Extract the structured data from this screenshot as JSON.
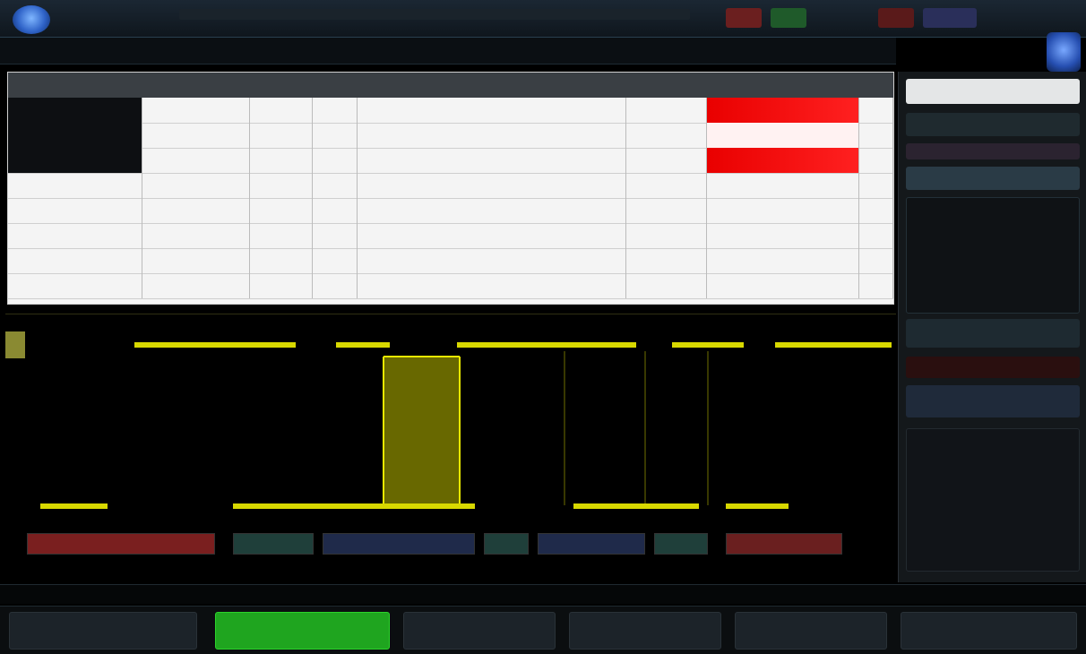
{
  "top_bar": {
    "items": [
      "",
      "",
      "",
      "",
      ""
    ],
    "badges": [
      {
        "color": "#6b1f1f"
      },
      {
        "color": "#1f5a2a"
      },
      {
        "color": "#5a1a1a"
      },
      {
        "color": "#2a2f5a"
      }
    ]
  },
  "menu": {
    "items": [
      "",
      ""
    ]
  },
  "table": {
    "columns": [
      "",
      "",
      "",
      "",
      "",
      "",
      "",
      "",
      ""
    ],
    "rows": [
      {
        "left": "",
        "cells": [
          "",
          "",
          "",
          "",
          "",
          "",
          ""
        ],
        "flag": "red"
      },
      {
        "left": "",
        "cells": [
          "",
          "",
          "",
          "",
          "",
          "",
          ""
        ],
        "flag": "none"
      },
      {
        "left": "",
        "cells": [
          "",
          "",
          "",
          "",
          "",
          "",
          ""
        ],
        "flag": "red"
      },
      {
        "left": "",
        "cells": [
          "",
          "",
          "",
          "",
          "",
          "",
          ""
        ],
        "flag": "none"
      },
      {
        "left": "",
        "cells": [
          "",
          "",
          "",
          "",
          "",
          "",
          ""
        ],
        "flag": "none"
      },
      {
        "left": "",
        "cells": [
          "",
          "",
          "",
          "",
          "",
          "",
          ""
        ],
        "flag": "none"
      },
      {
        "left": "",
        "cells": [
          "",
          "",
          "",
          "",
          "",
          "",
          ""
        ],
        "flag": "none"
      },
      {
        "left": "",
        "cells": [
          "",
          "",
          "",
          "",
          "",
          "",
          ""
        ],
        "flag": "none"
      }
    ]
  },
  "protocol_bar": {
    "segments": [
      {
        "label": "",
        "color": "#7a1f1f"
      },
      {
        "label": "",
        "color": "#1f3f3a"
      },
      {
        "label": "",
        "color": "#1f2a4a"
      },
      {
        "label": "",
        "color": "#1f3f3a"
      },
      {
        "label": "",
        "color": "#1f2a4a"
      },
      {
        "label": "",
        "color": "#1f3f3a"
      },
      {
        "label": "",
        "color": "#6a1f1f"
      }
    ]
  },
  "right_panel": {
    "labels": [
      "",
      "",
      "",
      "",
      "",
      ""
    ]
  },
  "status": {
    "text": ""
  },
  "softkeys": {
    "items": [
      {
        "label": "",
        "active": false
      },
      {
        "label": "",
        "active": true
      },
      {
        "label": "",
        "active": false
      },
      {
        "label": "",
        "active": false
      },
      {
        "label": "",
        "active": false
      },
      {
        "label": "",
        "active": false
      }
    ]
  },
  "colors": {
    "signal": "#d8d800",
    "accent_green": "#1fa51f",
    "flag_red": "#e90000"
  }
}
